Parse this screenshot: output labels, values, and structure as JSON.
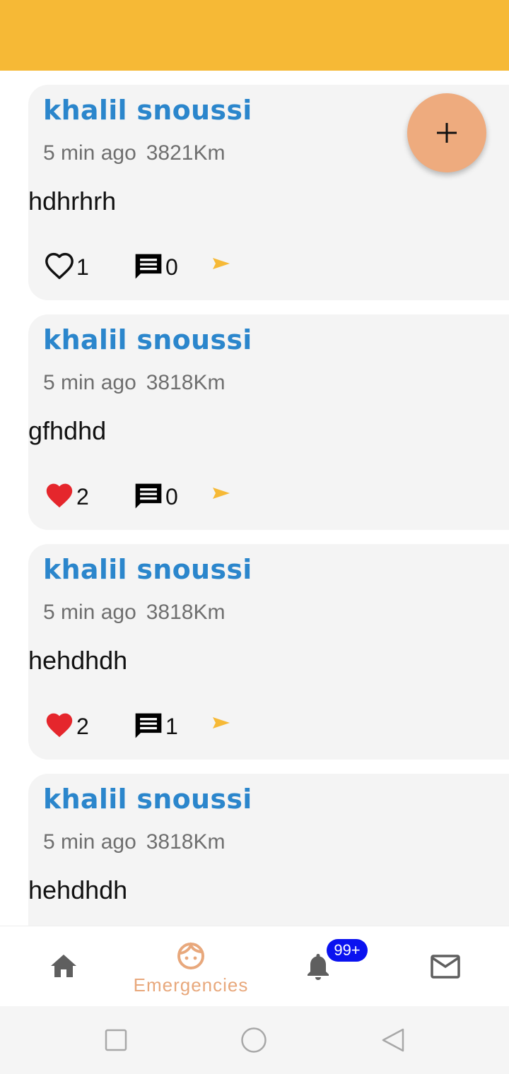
{
  "colors": {
    "app_bar": "#f6b936",
    "author": "#2b86cc",
    "fab": "#eeab7e",
    "accent_nav": "#e8a87c",
    "liked_heart": "#e5262c",
    "share_icon": "#f6b936",
    "badge": "#0a12f0"
  },
  "posts": [
    {
      "author": "khalil snoussi",
      "time": "5 min ago",
      "distance": "3821Km",
      "text": "hdhrhrh",
      "likes": "1",
      "liked": false,
      "comments": "0"
    },
    {
      "author": "khalil snoussi",
      "time": "5 min ago",
      "distance": "3818Km",
      "text": "gfhdhd",
      "likes": "2",
      "liked": true,
      "comments": "0"
    },
    {
      "author": "khalil snoussi",
      "time": "5 min ago",
      "distance": "3818Km",
      "text": "hehdhdh",
      "likes": "2",
      "liked": true,
      "comments": "1"
    },
    {
      "author": "khalil snoussi",
      "time": "5 min ago",
      "distance": "3818Km",
      "text": "hehdhdh"
    }
  ],
  "fab": {
    "icon": "plus-icon"
  },
  "bottom_nav": {
    "home": {
      "icon": "home-icon"
    },
    "emergencies": {
      "icon": "face-icon",
      "label": "Emergencies",
      "active": true
    },
    "notifications": {
      "icon": "bell-icon",
      "badge": "99+"
    },
    "messages": {
      "icon": "mail-icon"
    }
  },
  "system_nav": {
    "recents": "square-icon",
    "home": "circle-icon",
    "back": "triangle-back-icon"
  }
}
